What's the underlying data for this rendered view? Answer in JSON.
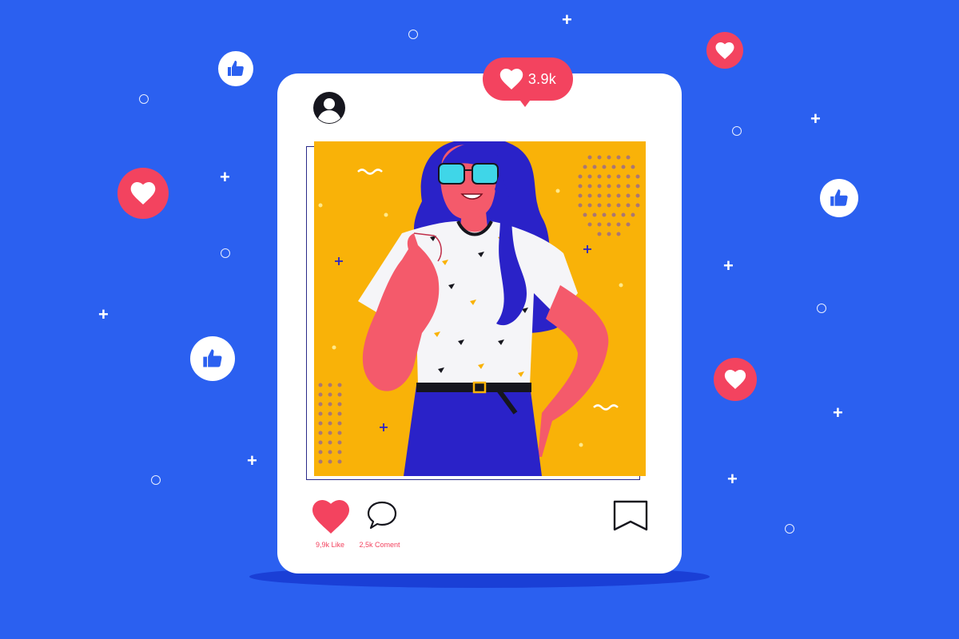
{
  "post": {
    "like_bubble_count": "3.9k",
    "like_label": "9,9k Like",
    "comment_label": "2,5k Coment"
  },
  "icons": {
    "avatar": "user-avatar-icon",
    "like": "heart-icon",
    "comment": "speech-bubble-icon",
    "save": "bookmark-icon",
    "thumbs": "thumbs-up-icon"
  },
  "colors": {
    "background": "#2b60f0",
    "card": "#ffffff",
    "photo_bg": "#f9b208",
    "accent_red": "#f3435f",
    "hair": "#2a22c8",
    "skin": "#f45a6b"
  }
}
